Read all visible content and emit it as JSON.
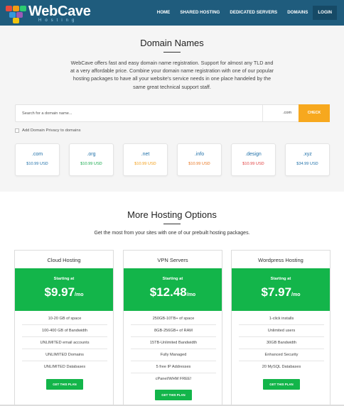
{
  "brand": {
    "name": "WebCave",
    "tagline": "Hosting",
    "logo_colors": [
      "#e84c3d",
      "#f39c12",
      "#2ecc71",
      "#3498db",
      "#9b59b6",
      "#f1c40f"
    ]
  },
  "nav": {
    "items": [
      {
        "label": "HOME"
      },
      {
        "label": "SHARED HOSTING"
      },
      {
        "label": "DEDICATED SERVERS"
      },
      {
        "label": "DOMAINS"
      },
      {
        "label": "LOGIN"
      }
    ]
  },
  "domains": {
    "title": "Domain Names",
    "intro": "WebCave offers fast and easy domain name registration. Support for almost any TLD and at a very affordable price. Combine your domain name registration with one of our popular hosting packages to have all your website's service needs in one place handeled by the same great technical support staff.",
    "search": {
      "placeholder": "Search for a domain name...",
      "value": "",
      "tld_selected": ".com",
      "button_label": "CHECK"
    },
    "privacy_label": "Add Domain Privacy to domains",
    "tlds": [
      {
        "name": ".com",
        "price": "$10.99 USD",
        "price_color": "#1e6fa8"
      },
      {
        "name": ".org",
        "price": "$10.99 USD",
        "price_color": "#13a84a"
      },
      {
        "name": ".net",
        "price": "$10.99 USD",
        "price_color": "#f39c12"
      },
      {
        "name": ".info",
        "price": "$10.99 USD",
        "price_color": "#e8731d"
      },
      {
        "name": ".design",
        "price": "$10.99 USD",
        "price_color": "#e03b3b"
      },
      {
        "name": ".xyz",
        "price": "$34.99 USD",
        "price_color": "#1e6fa8"
      }
    ]
  },
  "hosting": {
    "title": "More Hosting Options",
    "subtitle": "Get the most from your sites with one of our prebuilt hosting packages.",
    "plans": [
      {
        "name": "Cloud Hosting",
        "starting_label": "Starting at",
        "price": "$9.97",
        "period": "/mo",
        "features": [
          "10-20 GB of space",
          "100-400 GB of Bandwidth",
          "UNLIMITED email accounts",
          "UNLIMITED Domains",
          "UNLIMITED Databases"
        ],
        "button_label": "GET THIS PLAN"
      },
      {
        "name": "VPN Servers",
        "starting_label": "Starting at",
        "price": "$12.48",
        "period": "/mo",
        "features": [
          "250GB-10TB+ of space",
          "8GB-256GB+ of RAM",
          "15TB-Unlimited Bandwidth",
          "Fully Managed",
          "5 free IP Addresses",
          "cPanel/WHM FREE!"
        ],
        "button_label": "GET THIS PLAN"
      },
      {
        "name": "Wordpress Hosting",
        "starting_label": "Starting at",
        "price": "$7.97",
        "period": "/mo",
        "features": [
          "1-click installs",
          "Unlimited users",
          "30GB Bandwidth",
          "Enhanced Security",
          "20 MySQL Databases"
        ],
        "button_label": "GET THIS PLAN"
      }
    ]
  },
  "colors": {
    "header": "#1f5c7d",
    "accent_green": "#13b54a",
    "check_button": "#f7a81e"
  }
}
